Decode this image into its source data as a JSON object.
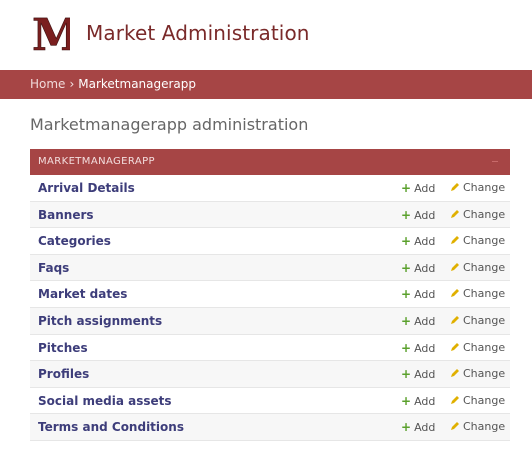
{
  "header": {
    "logo_letter": "M",
    "site_title": "Market Administration"
  },
  "breadcrumbs": {
    "home": "Home",
    "separator": "›",
    "current": "Marketmanagerapp"
  },
  "page_title": "Marketmanagerapp administration",
  "module": {
    "caption": "MARKETMANAGERAPP",
    "add_label": "Add",
    "change_label": "Change",
    "models": [
      "Arrival Details",
      "Banners",
      "Categories",
      "Faqs",
      "Market dates",
      "Pitch assignments",
      "Pitches",
      "Profiles",
      "Social media assets",
      "Terms and Conditions"
    ]
  },
  "colors": {
    "brand": "#a64545",
    "title": "#7a2a2a",
    "link": "#3d3d7a",
    "add_icon": "#5aa02c",
    "change_icon": "#e0b000"
  },
  "icons": [
    "plus-icon",
    "pencil-icon",
    "logo-m-icon"
  ]
}
